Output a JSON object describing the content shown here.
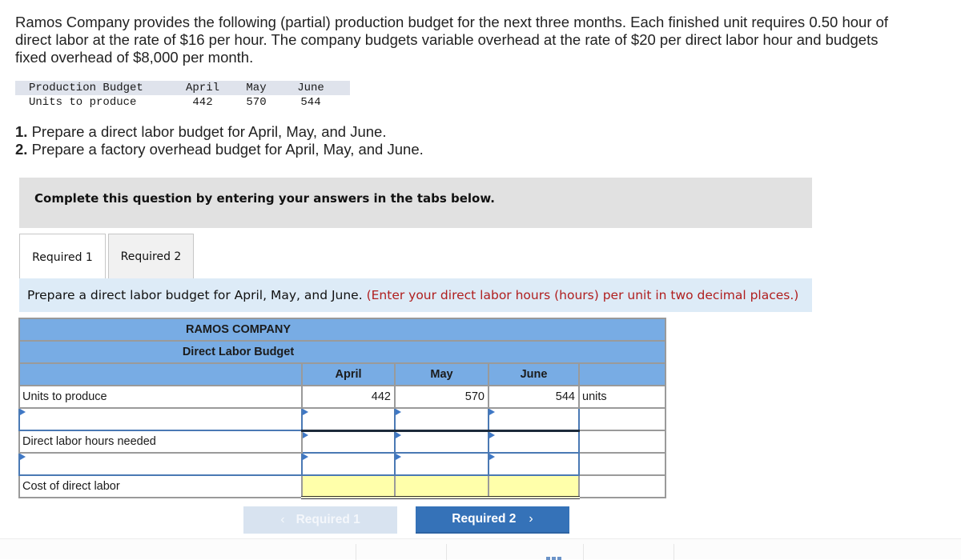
{
  "intro": "Ramos Company provides the following (partial) production budget for the next three months. Each finished unit requires 0.50 hour of direct labor at the rate of $16 per hour. The company budgets variable overhead at the rate of $20 per direct labor hour and budgets fixed overhead of $8,000 per month.",
  "production_budget": {
    "header": [
      "Production Budget",
      "April",
      "May",
      "June"
    ],
    "row": [
      "Units to produce",
      "442",
      "570",
      "544"
    ]
  },
  "requirements": [
    {
      "num": "1.",
      "text": " Prepare a direct labor budget for April, May, and June."
    },
    {
      "num": "2.",
      "text": " Prepare a factory overhead budget for April, May, and June."
    }
  ],
  "instruction_box": "Complete this question by entering your answers in the tabs below.",
  "tabs": [
    {
      "label": "Required 1",
      "active": true
    },
    {
      "label": "Required 2",
      "active": false
    }
  ],
  "prompt": {
    "text": "Prepare a direct labor budget for April, May, and June. ",
    "note": "(Enter your direct labor hours (hours) per unit in two decimal places.)",
    "note_color": "#b01e1e"
  },
  "budget_table": {
    "company": "RAMOS COMPANY",
    "title": "Direct Labor Budget",
    "months": [
      "April",
      "May",
      "June"
    ],
    "rows": [
      {
        "label": "Units to produce",
        "values": [
          "442",
          "570",
          "544"
        ],
        "suffix": "units"
      },
      {
        "label": "",
        "values": [
          "",
          "",
          ""
        ],
        "suffix": ""
      },
      {
        "label": "Direct labor hours needed",
        "values": [
          "",
          "",
          ""
        ],
        "suffix": ""
      },
      {
        "label": "",
        "values": [
          "",
          "",
          ""
        ],
        "suffix": ""
      },
      {
        "label": "Cost of direct labor",
        "values": [
          "",
          "",
          ""
        ],
        "suffix": ""
      }
    ]
  },
  "nav": {
    "prev_label": "Required 1",
    "next_label": "Required 2",
    "prev_icon": "‹",
    "next_icon": "›"
  }
}
